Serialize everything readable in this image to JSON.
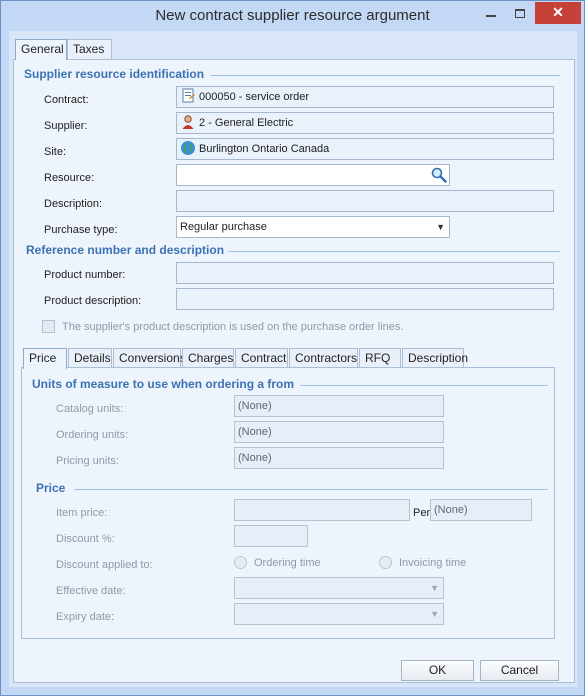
{
  "window": {
    "title": "New contract supplier resource argument",
    "minimize_label": "",
    "maximize_label": "",
    "close_label": "✕"
  },
  "main_tabs": [
    {
      "label": "General",
      "active": true
    },
    {
      "label": "Taxes",
      "active": false
    }
  ],
  "identification": {
    "header": "Supplier resource identification",
    "contract_label": "Contract:",
    "contract_value": "000050 - service order",
    "supplier_label": "Supplier:",
    "supplier_value": "2 - General Electric",
    "site_label": "Site:",
    "site_value": "Burlington Ontario Canada",
    "resource_label": "Resource:",
    "resource_value": "",
    "description_label": "Description:",
    "description_value": "",
    "purchase_type_label": "Purchase type:",
    "purchase_type_value": "Regular purchase"
  },
  "reference": {
    "header": "Reference number and description",
    "product_number_label": "Product number:",
    "product_number_value": "",
    "product_description_label": "Product description:",
    "product_description_value": "",
    "checkbox_label": "The supplier's product description is used on the purchase order lines.",
    "checkbox_checked": false
  },
  "inner_tabs": [
    {
      "label": "Price",
      "active": true
    },
    {
      "label": "Details",
      "active": false
    },
    {
      "label": "Conversions",
      "active": false
    },
    {
      "label": "Charges",
      "active": false
    },
    {
      "label": "Contract",
      "active": false
    },
    {
      "label": "Contractors",
      "active": false
    },
    {
      "label": "RFQ",
      "active": false
    },
    {
      "label": "Description",
      "active": false
    }
  ],
  "units": {
    "header": "Units of measure to use when ordering a  from",
    "catalog_label": "Catalog units:",
    "catalog_value": "(None)",
    "ordering_label": "Ordering units:",
    "ordering_value": "(None)",
    "pricing_label": "Pricing units:",
    "pricing_value": "(None)"
  },
  "price": {
    "header": "Price",
    "item_price_label": "Item price:",
    "item_price_value": "",
    "per_label": "Per",
    "per_value": "(None)",
    "discount_label": "Discount %:",
    "discount_value": "",
    "discount_applied_label": "Discount applied to:",
    "ordering_time_label": "Ordering time",
    "invoicing_time_label": "Invoicing time",
    "effective_date_label": "Effective date:",
    "effective_date_value": "",
    "expiry_date_label": "Expiry date:",
    "expiry_date_value": ""
  },
  "buttons": {
    "ok": "OK",
    "cancel": "Cancel"
  },
  "icons": {
    "contract": "contract-document-icon",
    "supplier": "supplier-person-icon",
    "site": "globe-icon",
    "resource_search": "magnifier-icon"
  },
  "colors": {
    "accent": "#3c72b3",
    "close_button": "#c7413b",
    "window_frame": "#c2d8f4"
  }
}
